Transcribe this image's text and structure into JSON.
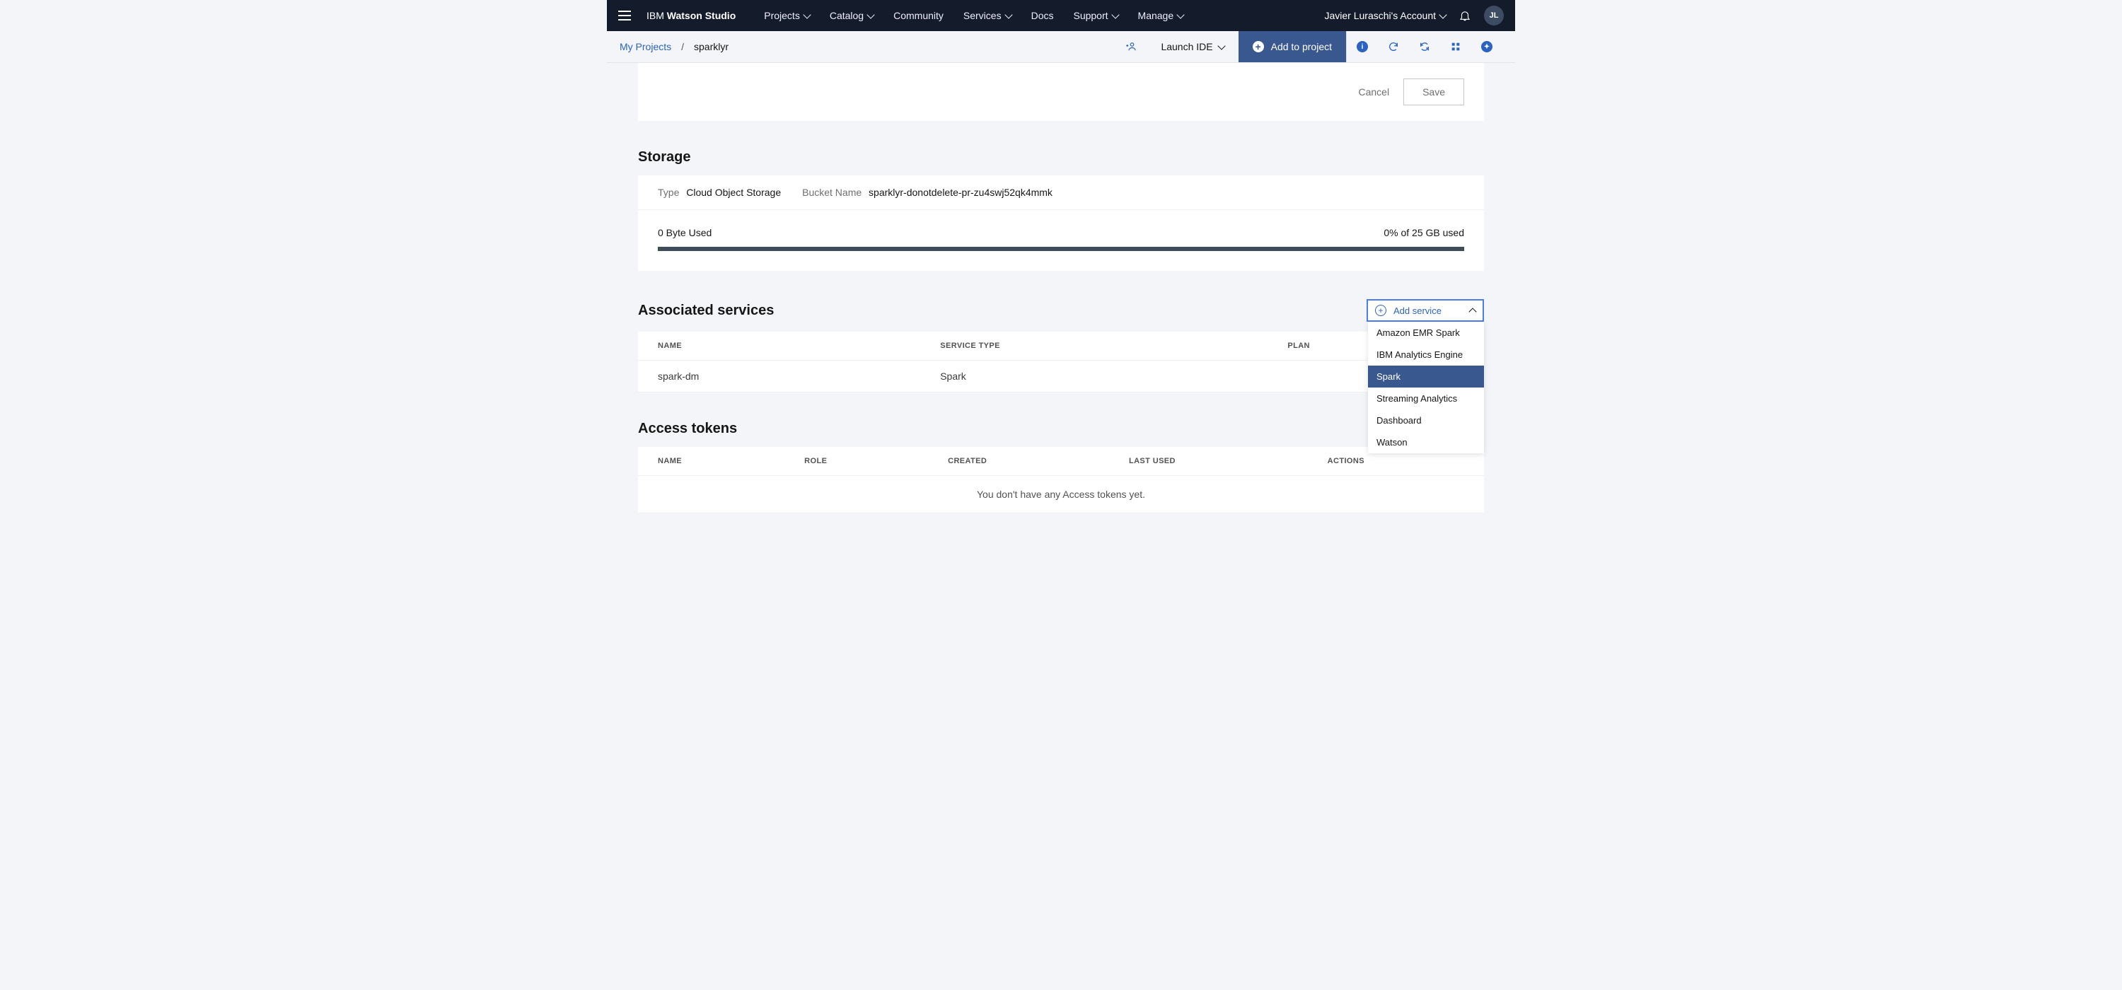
{
  "brand": {
    "prefix": "IBM ",
    "name": "Watson Studio"
  },
  "topnav": {
    "projects": "Projects",
    "catalog": "Catalog",
    "community": "Community",
    "services": "Services",
    "docs": "Docs",
    "support": "Support",
    "manage": "Manage"
  },
  "account": {
    "label": "Javier Luraschi's Account"
  },
  "avatar": "JL",
  "breadcrumb": {
    "root": "My Projects",
    "sep": "/",
    "current": "sparklyr"
  },
  "subactions": {
    "launch": "Launch IDE",
    "add": "Add to project"
  },
  "actions": {
    "cancel": "Cancel",
    "save": "Save"
  },
  "storage": {
    "title": "Storage",
    "type_label": "Type",
    "type_value": "Cloud Object Storage",
    "bucket_label": "Bucket Name",
    "bucket_value": "sparklyr-donotdelete-pr-zu4swj52qk4mmk",
    "used": "0 Byte Used",
    "quota": "0% of 25 GB used"
  },
  "services": {
    "title": "Associated services",
    "add_label": "Add service",
    "columns": {
      "name": "NAME",
      "type": "SERVICE TYPE",
      "plan": "PLAN"
    },
    "rows": [
      {
        "name": "spark-dm",
        "type": "Spark",
        "plan": ""
      }
    ],
    "dropdown": [
      {
        "label": "Amazon EMR Spark",
        "selected": false
      },
      {
        "label": "IBM Analytics Engine",
        "selected": false
      },
      {
        "label": "Spark",
        "selected": true
      },
      {
        "label": "Streaming Analytics",
        "selected": false
      },
      {
        "label": "Dashboard",
        "selected": false
      },
      {
        "label": "Watson",
        "selected": false
      }
    ]
  },
  "tokens": {
    "title": "Access tokens",
    "columns": {
      "name": "NAME",
      "role": "ROLE",
      "created": "CREATED",
      "last_used": "LAST USED",
      "actions": "ACTIONS"
    },
    "empty": "You don't have any Access tokens yet."
  }
}
